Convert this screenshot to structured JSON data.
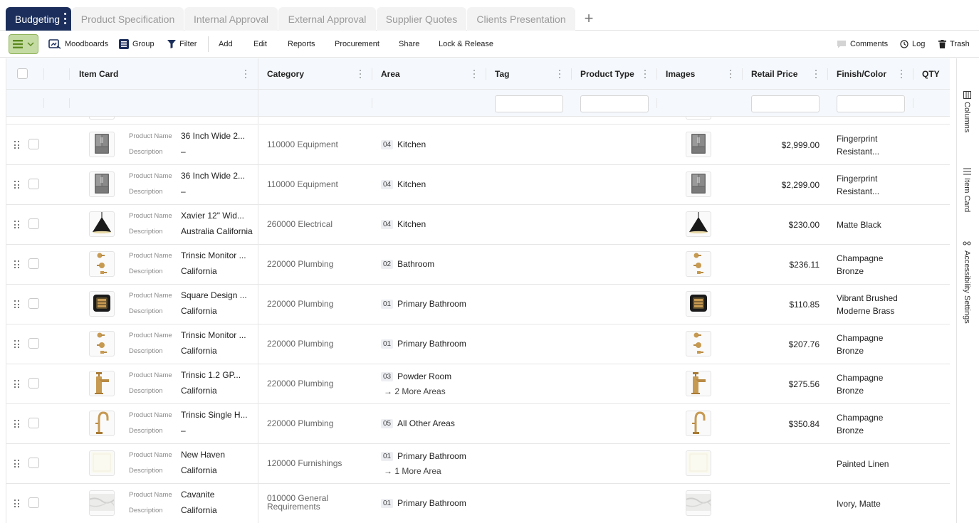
{
  "tabs": [
    {
      "label": "Budgeting",
      "active": true
    },
    {
      "label": "Product Specification"
    },
    {
      "label": "Internal Approval"
    },
    {
      "label": "External Approval"
    },
    {
      "label": "Supplier Quotes"
    },
    {
      "label": "Clients Presentation"
    }
  ],
  "toolbar": {
    "moodboards": "Moodboards",
    "group": "Group",
    "filter": "Filter",
    "add": "Add",
    "edit": "Edit",
    "reports": "Reports",
    "procurement": "Procurement",
    "share": "Share",
    "lock_release": "Lock & Release",
    "comments": "Comments",
    "log": "Log",
    "trash": "Trash"
  },
  "columns": {
    "item_card": "Item Card",
    "category": "Category",
    "area": "Area",
    "tag": "Tag",
    "product_type": "Product Type",
    "images": "Images",
    "retail_price": "Retail Price",
    "finish_color": "Finish/Color",
    "qty": "QTY"
  },
  "labels": {
    "product_name": "Product Name",
    "description": "Description"
  },
  "side_panel": {
    "columns": "Columns",
    "item_card": "Item Card",
    "accessibility": "Accessibility Settings"
  },
  "rows": [
    {
      "name": "36 Inch Wide 2...",
      "description": "–",
      "category": "110000 Equipment",
      "area_num": "04",
      "area": "Kitchen",
      "more": "",
      "price": "$2,999.00",
      "finish": "Fingerprint Resistant...",
      "icon": "fridge-icon"
    },
    {
      "name": "36 Inch Wide 2...",
      "description": "–",
      "category": "110000 Equipment",
      "area_num": "04",
      "area": "Kitchen",
      "more": "",
      "price": "$2,299.00",
      "finish": "Fingerprint Resistant...",
      "icon": "fridge-icon"
    },
    {
      "name": "Xavier 12\" Wid...",
      "description": "Australia California",
      "category": "260000 Electrical",
      "area_num": "04",
      "area": "Kitchen",
      "more": "",
      "price": "$230.00",
      "finish": "Matte Black",
      "icon": "pendant-lamp-icon"
    },
    {
      "name": "Trinsic Monitor ...",
      "description": "California",
      "category": "220000 Plumbing",
      "area_num": "02",
      "area": "Bathroom",
      "more": "",
      "price": "$236.11",
      "finish": "Champagne Bronze",
      "icon": "shower-valve-icon"
    },
    {
      "name": "Square Design ...",
      "description": "California",
      "category": "220000 Plumbing",
      "area_num": "01",
      "area": "Primary Bathroom",
      "more": "",
      "price": "$110.85",
      "finish": "Vibrant Brushed Moderne Brass",
      "icon": "drain-icon"
    },
    {
      "name": "Trinsic Monitor ...",
      "description": "California",
      "category": "220000 Plumbing",
      "area_num": "01",
      "area": "Primary Bathroom",
      "more": "",
      "price": "$207.76",
      "finish": "Champagne Bronze",
      "icon": "shower-valve-icon"
    },
    {
      "name": "Trinsic 1.2 GP...",
      "description": "California",
      "category": "220000 Plumbing",
      "area_num": "03",
      "area": "Powder Room",
      "more": "→ 2 More Areas",
      "price": "$275.56",
      "finish": "Champagne Bronze",
      "icon": "faucet-icon"
    },
    {
      "name": "Trinsic Single H...",
      "description": "–",
      "category": "220000 Plumbing",
      "area_num": "05",
      "area": "All Other Areas",
      "more": "",
      "price": "$350.84",
      "finish": "Champagne Bronze",
      "icon": "kitchen-faucet-icon"
    },
    {
      "name": "New Haven",
      "description": "California",
      "category": "120000 Furnishings",
      "area_num": "01",
      "area": "Primary Bathroom",
      "more": "→ 1 More Area",
      "price": "",
      "finish": "Painted Linen",
      "icon": "cabinet-icon"
    },
    {
      "name": "Cavanite",
      "description": "California",
      "category": "010000 General Requirements",
      "area_num": "01",
      "area": "Primary Bathroom",
      "more": "",
      "price": "",
      "finish": "Ivory, Matte",
      "icon": "marble-tile-icon"
    }
  ]
}
